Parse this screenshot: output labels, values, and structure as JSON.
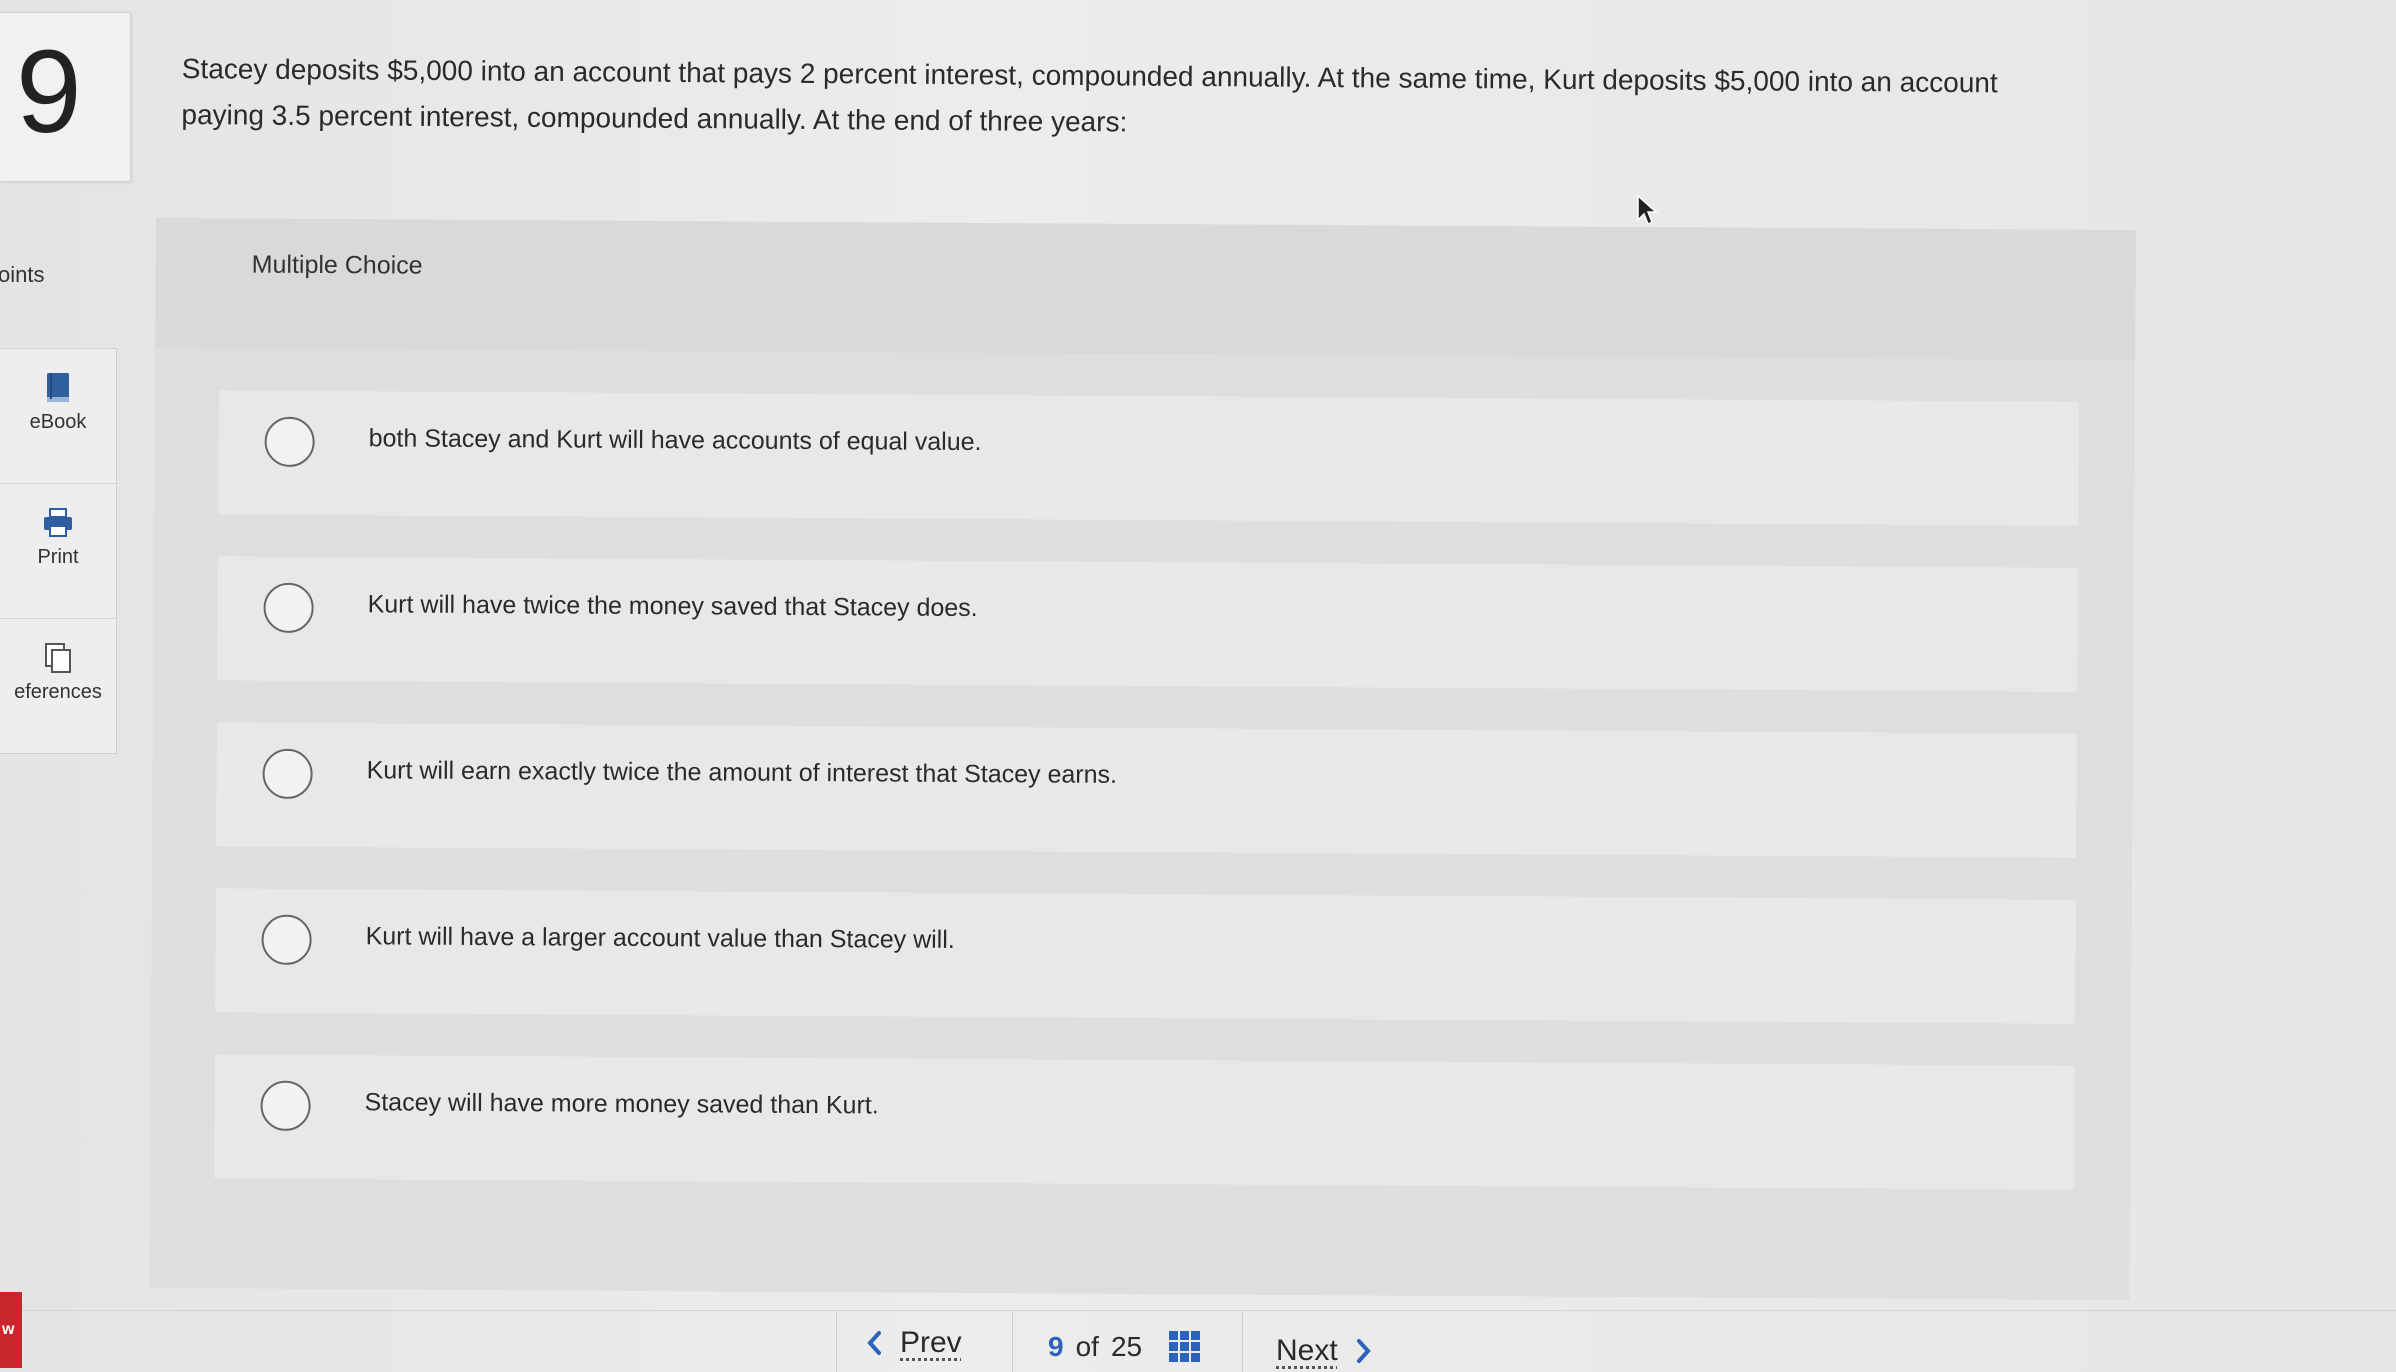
{
  "question": {
    "number": "9",
    "text": "Stacey deposits $5,000 into an account that pays 2 percent interest, compounded annually. At the same time, Kurt deposits $5,000 into an account paying 3.5 percent interest, compounded annually. At the end of three years:"
  },
  "sidebar": {
    "points_label": "oints",
    "tools": [
      {
        "label": "eBook",
        "icon": "book-icon"
      },
      {
        "label": "Print",
        "icon": "printer-icon"
      },
      {
        "label": "eferences",
        "icon": "references-icon"
      }
    ]
  },
  "multiple_choice": {
    "label": "Multiple Choice",
    "options": [
      {
        "text": "both Stacey and Kurt will have accounts of equal value.",
        "selected": false
      },
      {
        "text": "Kurt will have twice the money saved that Stacey does.",
        "selected": false
      },
      {
        "text": "Kurt will earn exactly twice the amount of interest that Stacey earns.",
        "selected": false
      },
      {
        "text": "Kurt will have a larger account value than Stacey will.",
        "selected": false
      },
      {
        "text": "Stacey will have more money saved than Kurt.",
        "selected": false
      }
    ]
  },
  "pager": {
    "prev_label": "Prev",
    "current": "9",
    "of_label": "of",
    "total": "25",
    "next_label": "Next"
  },
  "brand": {
    "label": "w",
    "color": "#c8252d"
  },
  "colors": {
    "accent": "#2a63b9"
  }
}
